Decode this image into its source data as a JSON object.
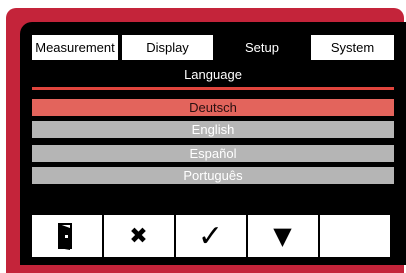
{
  "tabs": [
    {
      "label": "Measurement",
      "active": false
    },
    {
      "label": "Display",
      "active": false
    },
    {
      "label": "Setup",
      "active": true
    },
    {
      "label": "System",
      "active": false
    }
  ],
  "section": {
    "title": "Language"
  },
  "languages": [
    {
      "label": "Deutsch",
      "selected": true
    },
    {
      "label": "English",
      "selected": false
    },
    {
      "label": "Español",
      "selected": false
    },
    {
      "label": "Português",
      "selected": false
    }
  ],
  "toolbar": {
    "buttons": [
      {
        "icon": "exit-door-icon",
        "glyph": "▮"
      },
      {
        "icon": "close-x-icon",
        "glyph": "✖"
      },
      {
        "icon": "checkmark-icon",
        "glyph": "✓"
      },
      {
        "icon": "arrow-down-icon",
        "glyph": "▼"
      },
      {
        "icon": "",
        "glyph": ""
      }
    ]
  },
  "colors": {
    "frame": "#c4243a",
    "accent_line": "#e0453d",
    "selected_row": "#e3645c",
    "row": "#b5b5b5"
  }
}
